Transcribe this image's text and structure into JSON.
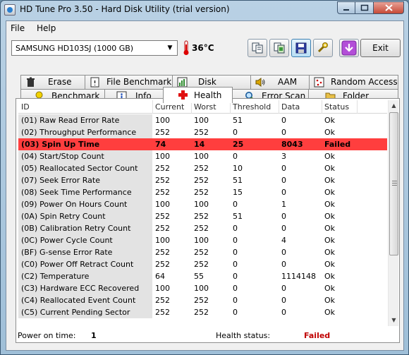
{
  "window": {
    "title": "HD Tune Pro 3.50 - Hard Disk Utility (trial version)"
  },
  "menu": [
    {
      "label": "File"
    },
    {
      "label": "Help"
    }
  ],
  "drive": {
    "selected": "SAMSUNG HD103SJ (1000 GB)"
  },
  "temperature": {
    "value": "36°C"
  },
  "exit_label": "Exit",
  "tabs_top": [
    {
      "label": "Erase",
      "icon": "trash-icon"
    },
    {
      "label": "File Benchmark",
      "icon": "file-benchmark-icon"
    },
    {
      "label": "Disk monitor",
      "icon": "disk-monitor-icon"
    },
    {
      "label": "AAM",
      "icon": "speaker-icon"
    },
    {
      "label": "Random Access",
      "icon": "random-access-icon"
    }
  ],
  "tabs_bottom": [
    {
      "label": "Benchmark",
      "icon": "bulb-icon"
    },
    {
      "label": "Info",
      "icon": "info-icon"
    },
    {
      "label": "Health",
      "icon": "red-cross-icon",
      "active": true
    },
    {
      "label": "Error Scan",
      "icon": "magnifier-icon"
    },
    {
      "label": "Folder Usage",
      "icon": "folder-icon"
    }
  ],
  "table": {
    "columns": [
      "ID",
      "Current",
      "Worst",
      "Threshold",
      "Data",
      "Status"
    ],
    "rows": [
      [
        "(01) Raw Read Error Rate",
        "100",
        "100",
        "51",
        "0",
        "Ok"
      ],
      [
        "(02) Throughput Performance",
        "252",
        "252",
        "0",
        "0",
        "Ok"
      ],
      [
        "(03) Spin Up Time",
        "74",
        "14",
        "25",
        "8043",
        "Failed"
      ],
      [
        "(04) Start/Stop Count",
        "100",
        "100",
        "0",
        "3",
        "Ok"
      ],
      [
        "(05) Reallocated Sector Count",
        "252",
        "252",
        "10",
        "0",
        "Ok"
      ],
      [
        "(07) Seek Error Rate",
        "252",
        "252",
        "51",
        "0",
        "Ok"
      ],
      [
        "(08) Seek Time Performance",
        "252",
        "252",
        "15",
        "0",
        "Ok"
      ],
      [
        "(09) Power On Hours Count",
        "100",
        "100",
        "0",
        "1",
        "Ok"
      ],
      [
        "(0A) Spin Retry Count",
        "252",
        "252",
        "51",
        "0",
        "Ok"
      ],
      [
        "(0B) Calibration Retry Count",
        "252",
        "252",
        "0",
        "0",
        "Ok"
      ],
      [
        "(0C) Power Cycle Count",
        "100",
        "100",
        "0",
        "4",
        "Ok"
      ],
      [
        "(BF) G-sense Error Rate",
        "252",
        "252",
        "0",
        "0",
        "Ok"
      ],
      [
        "(C0) Power Off Retract Count",
        "252",
        "252",
        "0",
        "0",
        "Ok"
      ],
      [
        "(C2) Temperature",
        "64",
        "55",
        "0",
        "1114148",
        "Ok"
      ],
      [
        "(C3) Hardware ECC Recovered",
        "100",
        "100",
        "0",
        "0",
        "Ok"
      ],
      [
        "(C4) Reallocated Event Count",
        "252",
        "252",
        "0",
        "0",
        "Ok"
      ],
      [
        "(C5) Current Pending Sector",
        "252",
        "252",
        "0",
        "0",
        "Ok"
      ]
    ]
  },
  "status": {
    "power_on_label": "Power on time:",
    "power_on_value": "1",
    "health_label": "Health status:",
    "health_value": "Failed"
  },
  "colors": {
    "failed_row": "#ff3e3e",
    "failed_text": "#c00000"
  }
}
